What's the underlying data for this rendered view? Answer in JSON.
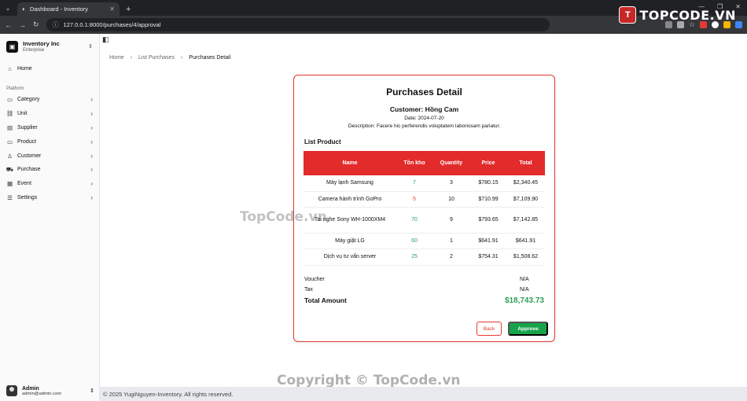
{
  "browser": {
    "tab_title": "Dashboard - Inventory",
    "url": "127.0.0.1:8000/purchases/4/approval",
    "brand": "TOPCODE.VN",
    "brand_badge": "T"
  },
  "sidebar": {
    "org_name": "Inventory Inc",
    "org_plan": "Enterprise",
    "home_label": "Home",
    "group_label": "Platform",
    "items": [
      {
        "label": "Category",
        "icon": "box-icon"
      },
      {
        "label": "Unit",
        "icon": "unit-icon"
      },
      {
        "label": "Supplier",
        "icon": "supplier-icon"
      },
      {
        "label": "Product",
        "icon": "product-icon"
      },
      {
        "label": "Customer",
        "icon": "customer-icon"
      },
      {
        "label": "Purchase",
        "icon": "cart-icon"
      },
      {
        "label": "Event",
        "icon": "calendar-icon"
      },
      {
        "label": "Settings",
        "icon": "settings-icon"
      }
    ],
    "user": {
      "name": "Admin",
      "email": "admin@admin.com"
    }
  },
  "breadcrumb": {
    "home": "Home",
    "list": "List Purchases",
    "current": "Purchases Detail"
  },
  "detail": {
    "title": "Purchases Detail",
    "customer": "Customer: Hồng Cam",
    "date": "Date: 2024-07-20",
    "description": "Description: Facere hic perferendis voluptatem laboriosam pariatur.",
    "list_heading": "List Product",
    "columns": {
      "name": "Name",
      "stock": "Tồn kho",
      "quantity": "Quantity",
      "price": "Price",
      "total": "Total"
    },
    "rows": [
      {
        "name": "Máy lạnh Samsung",
        "stock": "7",
        "quantity": "3",
        "price": "$780.15",
        "total": "$2,340.45"
      },
      {
        "name": "Camera hành trình GoPro",
        "stock": "5",
        "quantity": "10",
        "price": "$710.99",
        "total": "$7,109.90"
      },
      {
        "name": "Tai nghe Sony WH-1000XM4",
        "stock": "70",
        "quantity": "9",
        "price": "$793.65",
        "total": "$7,142.85"
      },
      {
        "name": "Máy giặt LG",
        "stock": "60",
        "quantity": "1",
        "price": "$641.91",
        "total": "$641.91"
      },
      {
        "name": "Dịch vụ tư vấn server",
        "stock": "25",
        "quantity": "2",
        "price": "$754.31",
        "total": "$1,508.62"
      }
    ],
    "voucher_label": "Voucher",
    "voucher_value": "N/A",
    "tax_label": "Tax",
    "tax_value": "N/A",
    "total_label": "Total Amount",
    "total_value": "$18,743.73",
    "back_label": "Back",
    "approve_label": "Approve"
  },
  "footer": "© 2025 YugiNguyen-Inventory. All rights reserved.",
  "watermark": "TopCode.vn",
  "watermark_bottom": "Copyright © TopCode.vn",
  "colors": {
    "accent": "#e22b2b",
    "success": "#16a34a",
    "stock_low": "#e53935",
    "stock_ok": "#2e9e5a"
  }
}
